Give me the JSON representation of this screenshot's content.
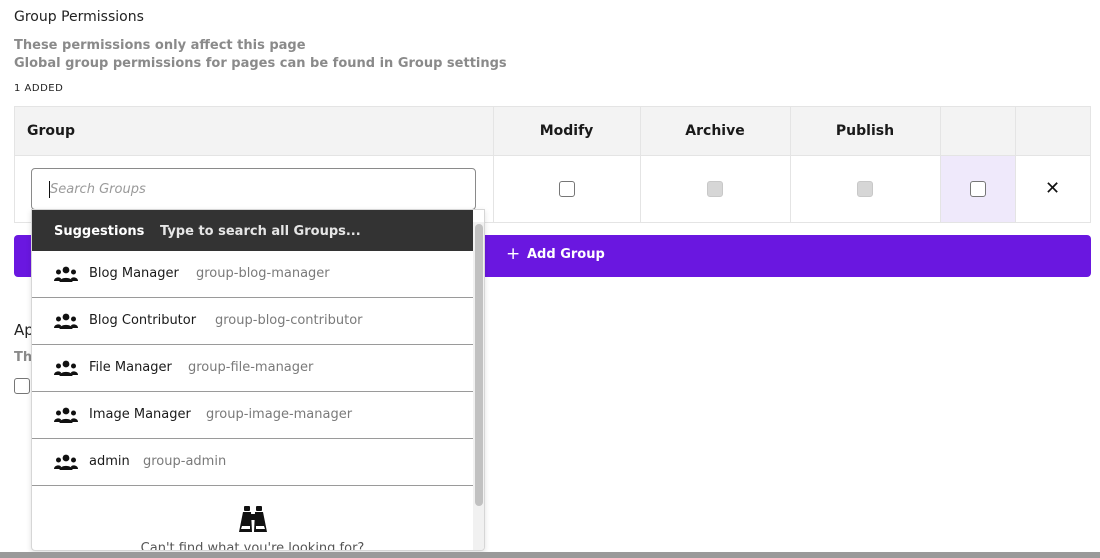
{
  "section": {
    "title": "Group Permissions",
    "description_line1": "These permissions only affect this page",
    "description_line2": "Global group permissions for pages can be found in Group settings",
    "added_count": "1 ADDED"
  },
  "table": {
    "headers": {
      "group": "Group",
      "modify": "Modify",
      "archive": "Archive",
      "publish": "Publish"
    },
    "row": {
      "modify_checked": false,
      "archive_disabled": true,
      "publish_disabled": true,
      "extra_checked": false,
      "remove_glyph": "✕"
    }
  },
  "search": {
    "placeholder": "Search Groups"
  },
  "dropdown": {
    "header_label": "Suggestions",
    "header_hint": "Type to search all Groups...",
    "items": [
      {
        "name": "Blog Manager",
        "slug": "group-blog-manager",
        "icon": "users-icon"
      },
      {
        "name": "Blog Contributor",
        "slug": "group-blog-contributor",
        "icon": "users-icon"
      },
      {
        "name": "File Manager",
        "slug": "group-file-manager",
        "icon": "users-icon"
      },
      {
        "name": "Image Manager",
        "slug": "group-image-manager",
        "icon": "users-icon"
      },
      {
        "name": "admin",
        "slug": "group-admin",
        "icon": "users-icon"
      }
    ],
    "empty_icon": "binoculars-icon",
    "empty_text": "Can't find what you're looking for?"
  },
  "add_group": {
    "plus": "+",
    "label": "Add Group"
  },
  "behind": {
    "heading_fragment": "Ap",
    "text_fragment": "Th"
  },
  "colors": {
    "accent": "#6a17e0",
    "column_highlight": "#efe9fb",
    "dropdown_header": "#333333"
  }
}
